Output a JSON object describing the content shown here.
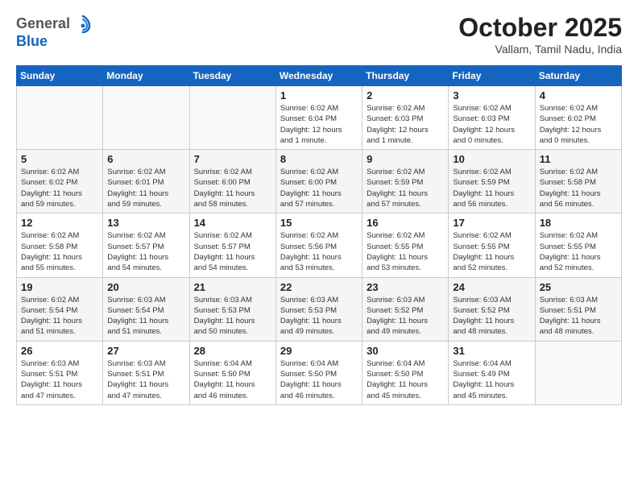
{
  "logo": {
    "general": "General",
    "blue": "Blue"
  },
  "header": {
    "month": "October 2025",
    "location": "Vallam, Tamil Nadu, India"
  },
  "weekdays": [
    "Sunday",
    "Monday",
    "Tuesday",
    "Wednesday",
    "Thursday",
    "Friday",
    "Saturday"
  ],
  "weeks": [
    [
      {
        "day": "",
        "info": ""
      },
      {
        "day": "",
        "info": ""
      },
      {
        "day": "",
        "info": ""
      },
      {
        "day": "1",
        "info": "Sunrise: 6:02 AM\nSunset: 6:04 PM\nDaylight: 12 hours\nand 1 minute."
      },
      {
        "day": "2",
        "info": "Sunrise: 6:02 AM\nSunset: 6:03 PM\nDaylight: 12 hours\nand 1 minute."
      },
      {
        "day": "3",
        "info": "Sunrise: 6:02 AM\nSunset: 6:03 PM\nDaylight: 12 hours\nand 0 minutes."
      },
      {
        "day": "4",
        "info": "Sunrise: 6:02 AM\nSunset: 6:02 PM\nDaylight: 12 hours\nand 0 minutes."
      }
    ],
    [
      {
        "day": "5",
        "info": "Sunrise: 6:02 AM\nSunset: 6:02 PM\nDaylight: 11 hours\nand 59 minutes."
      },
      {
        "day": "6",
        "info": "Sunrise: 6:02 AM\nSunset: 6:01 PM\nDaylight: 11 hours\nand 59 minutes."
      },
      {
        "day": "7",
        "info": "Sunrise: 6:02 AM\nSunset: 6:00 PM\nDaylight: 11 hours\nand 58 minutes."
      },
      {
        "day": "8",
        "info": "Sunrise: 6:02 AM\nSunset: 6:00 PM\nDaylight: 11 hours\nand 57 minutes."
      },
      {
        "day": "9",
        "info": "Sunrise: 6:02 AM\nSunset: 5:59 PM\nDaylight: 11 hours\nand 57 minutes."
      },
      {
        "day": "10",
        "info": "Sunrise: 6:02 AM\nSunset: 5:59 PM\nDaylight: 11 hours\nand 56 minutes."
      },
      {
        "day": "11",
        "info": "Sunrise: 6:02 AM\nSunset: 5:58 PM\nDaylight: 11 hours\nand 56 minutes."
      }
    ],
    [
      {
        "day": "12",
        "info": "Sunrise: 6:02 AM\nSunset: 5:58 PM\nDaylight: 11 hours\nand 55 minutes."
      },
      {
        "day": "13",
        "info": "Sunrise: 6:02 AM\nSunset: 5:57 PM\nDaylight: 11 hours\nand 54 minutes."
      },
      {
        "day": "14",
        "info": "Sunrise: 6:02 AM\nSunset: 5:57 PM\nDaylight: 11 hours\nand 54 minutes."
      },
      {
        "day": "15",
        "info": "Sunrise: 6:02 AM\nSunset: 5:56 PM\nDaylight: 11 hours\nand 53 minutes."
      },
      {
        "day": "16",
        "info": "Sunrise: 6:02 AM\nSunset: 5:55 PM\nDaylight: 11 hours\nand 53 minutes."
      },
      {
        "day": "17",
        "info": "Sunrise: 6:02 AM\nSunset: 5:55 PM\nDaylight: 11 hours\nand 52 minutes."
      },
      {
        "day": "18",
        "info": "Sunrise: 6:02 AM\nSunset: 5:55 PM\nDaylight: 11 hours\nand 52 minutes."
      }
    ],
    [
      {
        "day": "19",
        "info": "Sunrise: 6:02 AM\nSunset: 5:54 PM\nDaylight: 11 hours\nand 51 minutes."
      },
      {
        "day": "20",
        "info": "Sunrise: 6:03 AM\nSunset: 5:54 PM\nDaylight: 11 hours\nand 51 minutes."
      },
      {
        "day": "21",
        "info": "Sunrise: 6:03 AM\nSunset: 5:53 PM\nDaylight: 11 hours\nand 50 minutes."
      },
      {
        "day": "22",
        "info": "Sunrise: 6:03 AM\nSunset: 5:53 PM\nDaylight: 11 hours\nand 49 minutes."
      },
      {
        "day": "23",
        "info": "Sunrise: 6:03 AM\nSunset: 5:52 PM\nDaylight: 11 hours\nand 49 minutes."
      },
      {
        "day": "24",
        "info": "Sunrise: 6:03 AM\nSunset: 5:52 PM\nDaylight: 11 hours\nand 48 minutes."
      },
      {
        "day": "25",
        "info": "Sunrise: 6:03 AM\nSunset: 5:51 PM\nDaylight: 11 hours\nand 48 minutes."
      }
    ],
    [
      {
        "day": "26",
        "info": "Sunrise: 6:03 AM\nSunset: 5:51 PM\nDaylight: 11 hours\nand 47 minutes."
      },
      {
        "day": "27",
        "info": "Sunrise: 6:03 AM\nSunset: 5:51 PM\nDaylight: 11 hours\nand 47 minutes."
      },
      {
        "day": "28",
        "info": "Sunrise: 6:04 AM\nSunset: 5:50 PM\nDaylight: 11 hours\nand 46 minutes."
      },
      {
        "day": "29",
        "info": "Sunrise: 6:04 AM\nSunset: 5:50 PM\nDaylight: 11 hours\nand 46 minutes."
      },
      {
        "day": "30",
        "info": "Sunrise: 6:04 AM\nSunset: 5:50 PM\nDaylight: 11 hours\nand 45 minutes."
      },
      {
        "day": "31",
        "info": "Sunrise: 6:04 AM\nSunset: 5:49 PM\nDaylight: 11 hours\nand 45 minutes."
      },
      {
        "day": "",
        "info": ""
      }
    ]
  ]
}
